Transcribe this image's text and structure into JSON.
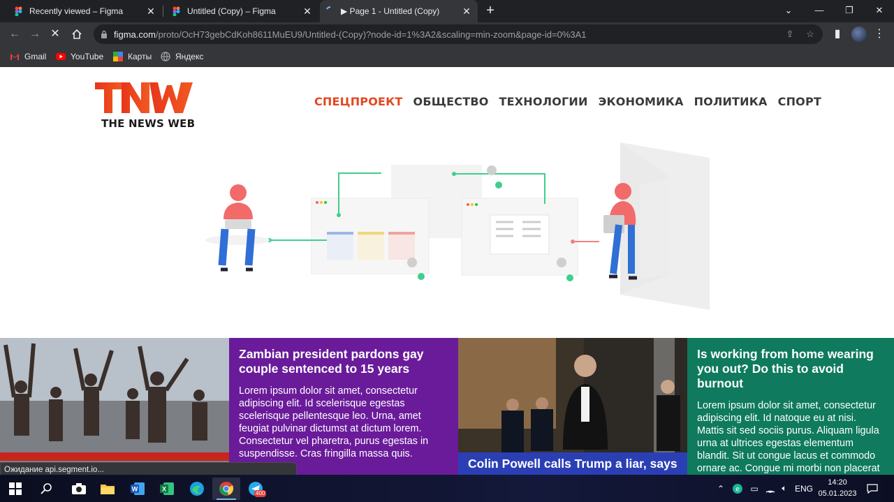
{
  "browser": {
    "tabs": [
      {
        "title": "Recently viewed – Figma",
        "active": false
      },
      {
        "title": "Untitled (Copy) – Figma",
        "active": false
      },
      {
        "title": "▶ Page 1 - Untitled (Copy)",
        "active": true
      }
    ],
    "new_tab": "+",
    "url_host": "figma.com",
    "url_path": "/proto/OcH73gebCdKoh8611MuEU9/Untitled-(Copy)?node-id=1%3A2&scaling=min-zoom&page-id=0%3A1",
    "bookmarks": [
      "Gmail",
      "YouTube",
      "Карты",
      "Яндекс"
    ],
    "status_text": "Ожидание api.segment.io..."
  },
  "site": {
    "logo_text": "TNW",
    "logo_subtitle": "THE NEWS WEB",
    "nav": [
      {
        "label": "СПЕЦПРОЕКТ",
        "active": true
      },
      {
        "label": "ОБЩЕСТВО",
        "active": false
      },
      {
        "label": "ТЕХНОЛОГИИ",
        "active": false
      },
      {
        "label": "ЭКОНОМИКА",
        "active": false
      },
      {
        "label": "ПОЛИТИКА",
        "active": false
      },
      {
        "label": "СПОРТ",
        "active": false
      }
    ],
    "accent_color": "#e5461f",
    "cards": [
      {
        "type": "photo"
      },
      {
        "type": "text",
        "color": "#6a1b9a",
        "headline": "Zambian president pardons gay couple sentenced to 15 years",
        "body": "Lorem ipsum dolor sit amet, consectetur adipiscing elit. Id scelerisque egestas scelerisque pellentesque leo. Urna, amet feugiat pulvinar dictumst at dictum lorem. Consectetur vel pharetra, purus egestas in suspendisse. Cras fringilla massa quis."
      },
      {
        "type": "photo",
        "caption": "Colin Powell calls Trump a liar, says"
      },
      {
        "type": "text",
        "color": "#0f7a5d",
        "headline": "Is working from home wearing you out? Do this to avoid burnout",
        "body": "Lorem ipsum dolor sit amet, consectetur adipiscing elit. Id natoque eu at nisi. Mattis sit sed sociis purus. Aliquam ligula urna at ultrices egestas elementum blandit. Sit ut congue lacus et commodo ornare ac. Congue mi morbi non placerat nullam."
      }
    ]
  },
  "taskbar": {
    "language": "ENG",
    "time": "14:20",
    "date": "05.01.2023",
    "telegram_badge": "400"
  }
}
